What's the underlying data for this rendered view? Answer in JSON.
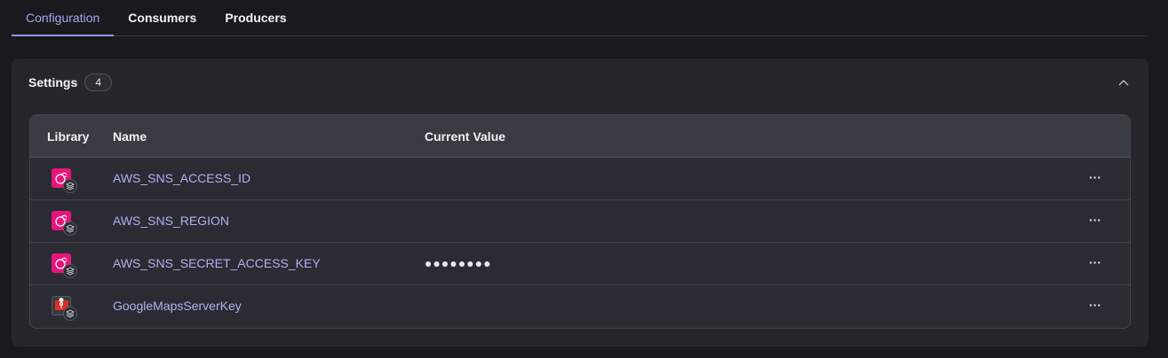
{
  "tabs": [
    {
      "label": "Configuration",
      "active": true
    },
    {
      "label": "Consumers",
      "active": false
    },
    {
      "label": "Producers",
      "active": false
    }
  ],
  "settings": {
    "title": "Settings",
    "count": "4",
    "collapse_icon": "chevron-up-icon"
  },
  "table": {
    "headers": {
      "library": "Library",
      "name": "Name",
      "value": "Current Value"
    },
    "rows": [
      {
        "icon": "aws-sns-icon",
        "name": "AWS_SNS_ACCESS_ID",
        "value": ""
      },
      {
        "icon": "aws-sns-icon",
        "name": "AWS_SNS_REGION",
        "value": ""
      },
      {
        "icon": "aws-sns-icon",
        "name": "AWS_SNS_SECRET_ACCESS_KEY",
        "value": "●●●●●●●●"
      },
      {
        "icon": "google-maps-icon",
        "name": "GoogleMapsServerKey",
        "value": ""
      }
    ],
    "more_label": "···"
  },
  "colors": {
    "accent": "#a3a8f0",
    "aws_pink": "#e7157b",
    "maps_red": "#d93025"
  }
}
